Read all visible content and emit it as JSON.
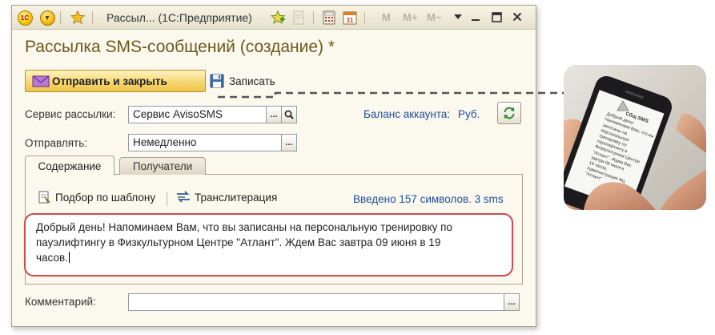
{
  "window": {
    "title": "Рассыл... (1С:Предприятие)",
    "faded_buttons": [
      "M",
      "M+",
      "M−"
    ]
  },
  "form": {
    "title": "Рассылка SMS-сообщений (создание) *",
    "send_close_label": "Отправить и закрыть",
    "save_label": "Записать"
  },
  "fields": {
    "service_label": "Сервис рассылки:",
    "service_value": "Сервис AvisoSMS",
    "send_label": "Отправлять:",
    "send_value": "Немедленно",
    "comment_label": "Комментарий:",
    "comment_value": ""
  },
  "balance": {
    "label": "Баланс аккаунта:",
    "currency": "Руб."
  },
  "tabs": [
    {
      "label": "Содержание",
      "active": true
    },
    {
      "label": "Получатели",
      "active": false
    }
  ],
  "content": {
    "template_button": "Подбор по шаблону",
    "translit_button": "Транслитерация",
    "counter": "Введено 157 символов. 3 sms",
    "message_lines": [
      "Добрый день! Напоминаем Вам, что вы записаны на персональную тренировку по",
      "пауэлифтингу в Физкультурном Центре \"Атлант\". Ждем Вас завтра 09 июня в 19",
      "часов."
    ]
  },
  "phone_screen": {
    "header": "Сбщ SMS",
    "lines": [
      "Добрый день!",
      "Напоминаем Вам, что вы",
      "записаны на",
      "персональную",
      "тренировку по",
      "пауэлифтингу в",
      "Физкультурном Центре",
      "\"Атлант\". Ждем Вас",
      "завтра 09 июня в",
      "19 часов.",
      "Администрация ФЦ",
      "\"Атлант\""
    ]
  },
  "colors": {
    "accent_title": "#6b5a1e",
    "link_blue": "#1d4f9e",
    "highlight_red": "#d24a4a",
    "send_button": "#f6d774"
  }
}
